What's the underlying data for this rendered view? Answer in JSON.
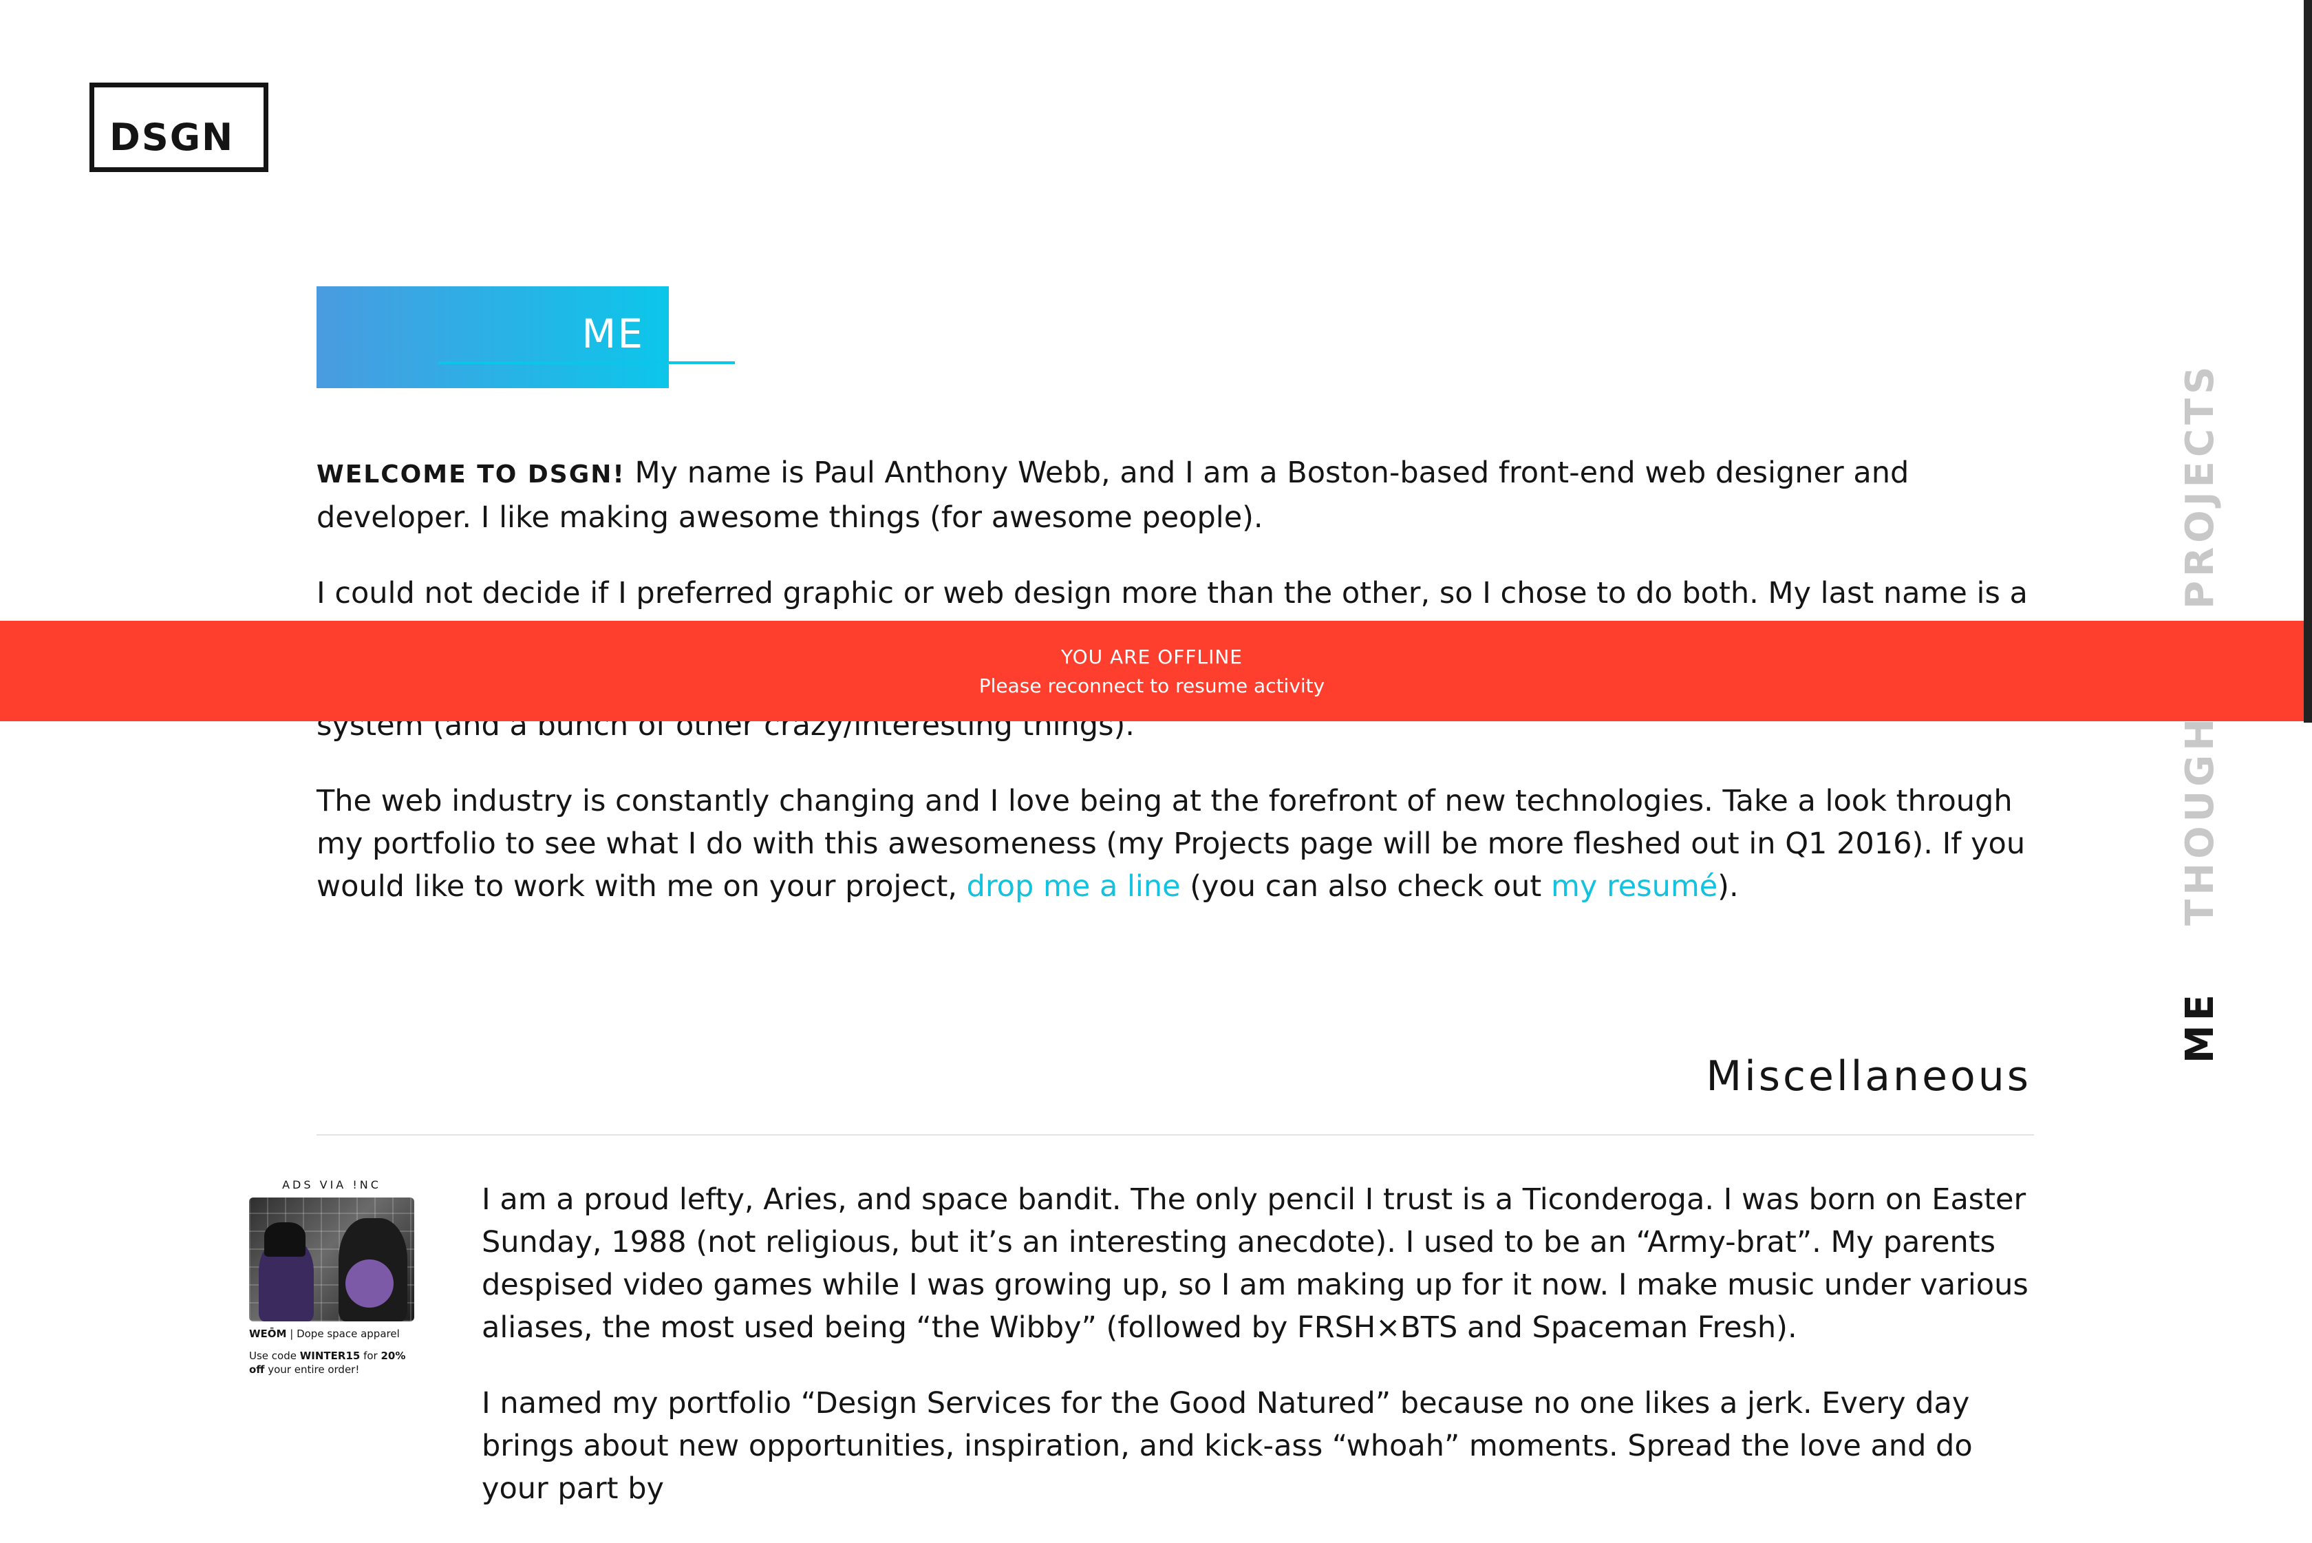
{
  "logo": {
    "text": "DSGN"
  },
  "hero": {
    "title": "ME"
  },
  "intro": {
    "lead": "WELCOME TO DSGN!",
    "p1_rest": " My name is Paul Anthony Webb, and I am a Boston-based front-end web designer and developer. I like making awesome things (for awesome people).",
    "p2": "I could not decide if I preferred graphic or web design more than the other, so I chose to do both. My last name is a",
    "p3": "Since 2008, I have coded and designed websites. Nowadays, I work on web apps, a browser, and an operating system (and a bunch of other crazy/interesting things).",
    "p4_a": "The web industry is constantly changing and I love being at the forefront of new technologies. Take a look through my portfolio to see what I do with this awesomeness (my Projects page will be more fleshed out in Q1 2016). If you would like to work with me on your project, ",
    "link1": "drop me a line",
    "p4_b": " (you can also check out ",
    "link2": "my resumé",
    "p4_c": ")."
  },
  "misc": {
    "title": "Miscellaneous",
    "p1": "I am a proud lefty, Aries, and space bandit. The only pencil I trust is a Ticonderoga. I was born on Easter Sunday, 1988 (not religious, but it’s an interesting anecdote). I used to be an “Army-brat”. My parents despised video games while I was growing up, so I am making up for it now. I make music under various aliases, the most used being “the Wibby” (followed by FRSH×BTS and Spaceman Fresh).",
    "p2": "I named my portfolio “Design Services for the Good Natured” because no one likes a jerk. Every day brings about new opportunities, inspiration, and kick-ass “whoah” moments. Spread the love and do your part by"
  },
  "ad": {
    "header": "ADS VIA !NC",
    "brand": "WEŌM",
    "tagline": " | Dope space apparel",
    "code_prefix": "Use code ",
    "code": "WINTER15",
    "code_mid": " for ",
    "discount": "20% off",
    "code_suffix": " your entire order!"
  },
  "nav": {
    "items": [
      {
        "label": "PROJECTS",
        "active": false
      },
      {
        "label": "THOUGHTS",
        "active": false
      },
      {
        "label": "ME",
        "active": true
      }
    ]
  },
  "offline": {
    "title": "YOU ARE OFFLINE",
    "message": "Please reconnect to resume activity"
  },
  "colors": {
    "accent": "#12c2df",
    "offline_bg": "#ff3f2e",
    "gradient_start": "#4a9be0",
    "gradient_end": "#0cc6ea"
  }
}
